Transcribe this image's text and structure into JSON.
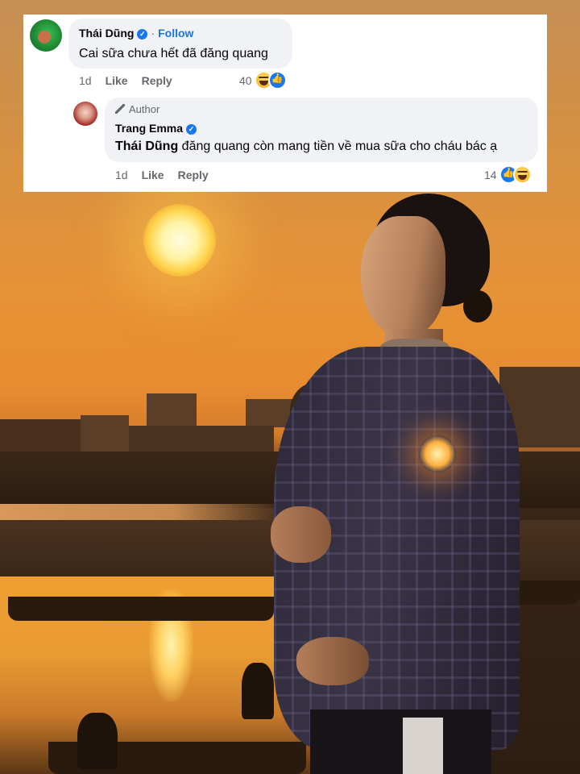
{
  "comments": [
    {
      "author": "Thái Dũng",
      "verified": true,
      "follow_label": "Follow",
      "text": "Cai sữa chưa hết đã đăng quang",
      "time": "1d",
      "like_label": "Like",
      "reply_label": "Reply",
      "reaction_count": "40",
      "reactions": [
        "haha-icon",
        "like-icon"
      ]
    }
  ],
  "reply": {
    "badge": "Author",
    "author": "Trang Emma",
    "verified": true,
    "mention": "Thái Dũng",
    "text": " đăng quang còn mang tiền về mua sữa cho cháu bác ạ",
    "time": "1d",
    "like_label": "Like",
    "reply_label": "Reply",
    "reaction_count": "14",
    "reactions": [
      "like-icon",
      "haha-icon"
    ]
  },
  "colors": {
    "link_blue": "#1b74e4",
    "bubble_bg": "#f0f2f5",
    "meta_gray": "#65676b",
    "verified_blue": "#1877f2"
  }
}
